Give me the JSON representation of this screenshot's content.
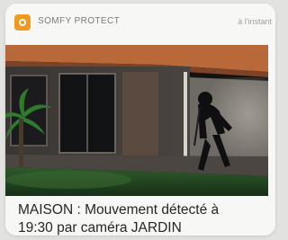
{
  "notification": {
    "app_icon": "somfy-app-icon",
    "app_name": "SOMFY PROTECT",
    "time": "à l'instant",
    "message_line1": "MAISON : Mouvement détecté à",
    "message_line2": "19:30 par caméra JARDIN",
    "accent_color": "#f29a1f"
  },
  "camera_image": {
    "description_icon": "security-camera-snapshot"
  }
}
